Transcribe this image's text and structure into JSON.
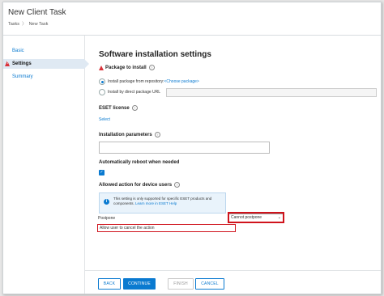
{
  "header": {
    "title": "New Client Task",
    "breadcrumb": [
      "Tasks",
      "New Task"
    ]
  },
  "nav": {
    "items": [
      {
        "label": "Basic"
      },
      {
        "label": "Settings",
        "state": "active",
        "warning": true
      },
      {
        "label": "Summary"
      }
    ]
  },
  "main": {
    "title": "Software installation settings",
    "package": {
      "heading": "Package to install",
      "option1_text": "Install package from repository:",
      "option1_link": "<Choose package>",
      "option2_text": "Install by direct package URL",
      "url_value": ""
    },
    "license": {
      "heading": "ESET license",
      "link": "Select"
    },
    "params": {
      "heading": "Installation parameters",
      "value": ""
    },
    "reboot": {
      "heading": "Automatically reboot when needed",
      "checked": true
    },
    "allowed": {
      "heading": "Allowed action for device users",
      "info_text": "This setting is only supported for specific ESET products and components.",
      "info_link": "Learn more in ESET Help",
      "postpone_label": "Postpone",
      "postpone_value": "Cannot postpone",
      "allow_cancel_label": "Allow user to cancel the action"
    }
  },
  "footer": {
    "back": "BACK",
    "continue": "CONTINUE",
    "finish": "FINISH",
    "cancel": "CANCEL"
  },
  "colors": {
    "accent": "#0a7ad0",
    "warning": "#d9323a",
    "highlight": "#d0131c"
  }
}
